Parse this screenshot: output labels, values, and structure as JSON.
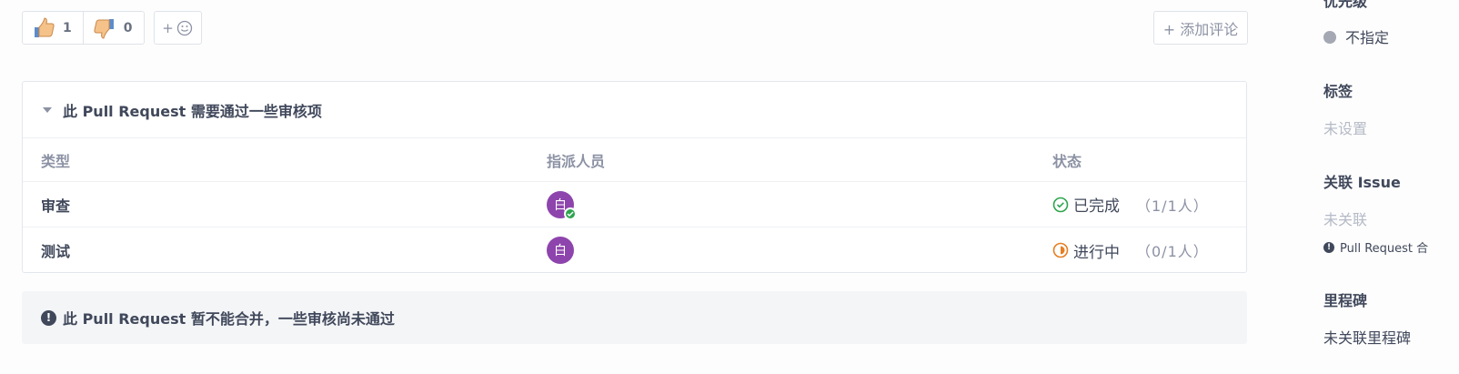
{
  "reactions": {
    "thumbs_up": {
      "icon": "thumbs-up-icon",
      "count": "1"
    },
    "thumbs_down": {
      "icon": "thumbs-down-icon",
      "count": "0"
    },
    "add_label": "+"
  },
  "add_comment_label": "+ 添加评论",
  "review": {
    "title": "此 Pull Request 需要通过一些审核项",
    "columns": {
      "type": "类型",
      "assignee": "指派人员",
      "status": "状态"
    },
    "rows": [
      {
        "type": "审查",
        "avatar": "白",
        "status": "已完成",
        "count": "（1/1人）",
        "state": "done"
      },
      {
        "type": "测试",
        "avatar": "白",
        "status": "进行中",
        "count": "（0/1人）",
        "state": "in-progress"
      }
    ]
  },
  "merge_notice": "此 Pull Request 暂不能合并，一些审核尚未通过",
  "sidebar": {
    "priority_title": "优先级",
    "priority_value": "不指定",
    "labels_title": "标签",
    "labels_value": "未设置",
    "issue_title": "关联 Issue",
    "issue_value": "未关联",
    "issue_note": "Pull Request 合",
    "milestone_title": "里程碑",
    "milestone_value": "未关联里程碑"
  },
  "colors": {
    "avatar": "#8e44ad",
    "done": "#2ea44f",
    "in_progress": "#e67e22"
  }
}
